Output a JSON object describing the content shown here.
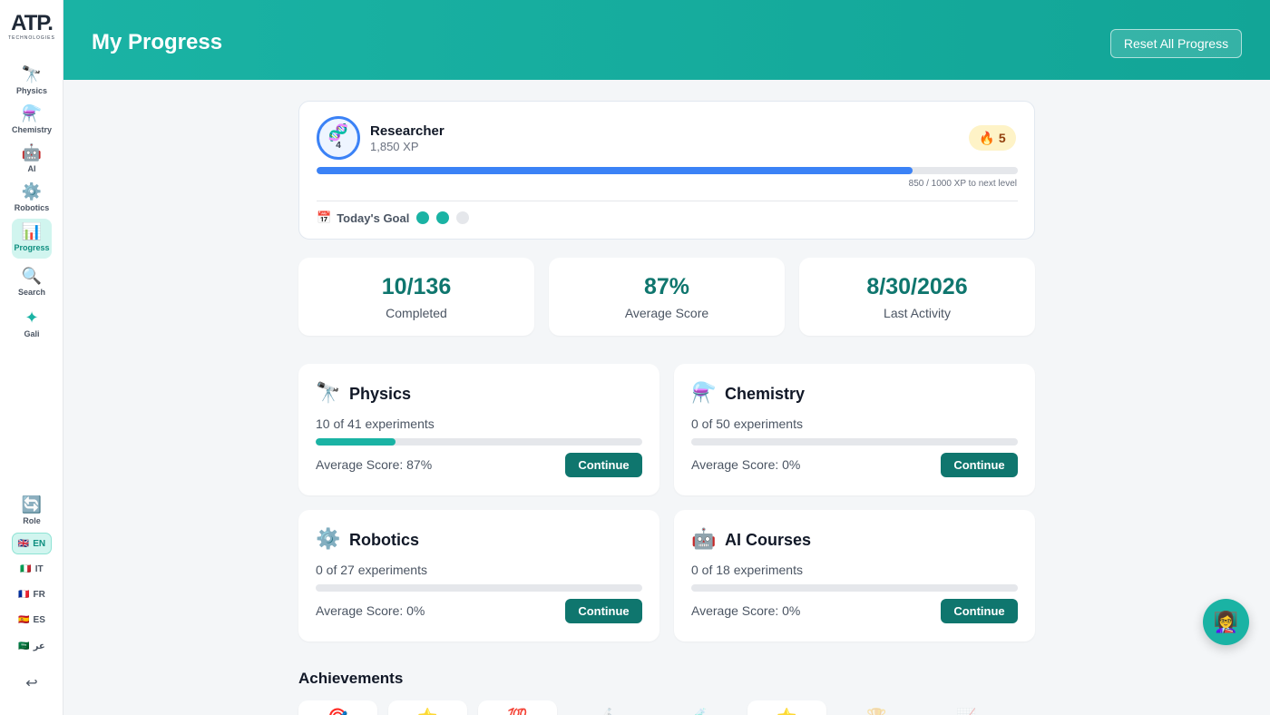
{
  "brand": {
    "logo": "ATP",
    "logo_dot": ".",
    "tagline": "TECHNOLOGIES"
  },
  "sidebar": {
    "items": [
      {
        "icon": "🔭",
        "label": "Physics"
      },
      {
        "icon": "⚗️",
        "label": "Chemistry"
      },
      {
        "icon": "🤖",
        "label": "AI"
      },
      {
        "icon": "⚙️",
        "label": "Robotics"
      },
      {
        "icon": "📊",
        "label": "Progress"
      },
      {
        "icon": "🔍",
        "label": "Search"
      },
      {
        "icon": "✦",
        "label": "Gali"
      }
    ],
    "role": {
      "icon": "🔄",
      "label": "Role"
    },
    "languages": [
      {
        "flag": "🇬🇧",
        "code": "EN"
      },
      {
        "flag": "🇮🇹",
        "code": "IT"
      },
      {
        "flag": "🇫🇷",
        "code": "FR"
      },
      {
        "flag": "🇪🇸",
        "code": "ES"
      },
      {
        "flag": "🇸🇦",
        "code": "عر"
      }
    ],
    "logout_icon": "↩"
  },
  "header": {
    "title": "My Progress",
    "reset_label": "Reset All Progress"
  },
  "profile": {
    "avatar_icon": "🧬",
    "level": "4",
    "rank": "Researcher",
    "xp": "1,850 XP",
    "streak_icon": "🔥",
    "streak": "5",
    "xp_progress": 0.85,
    "xp_next": "850 / 1000 XP to next level",
    "goal_icon": "📅",
    "goal_label": "Today's Goal",
    "goal_done": 2,
    "goal_total": 3
  },
  "stats": [
    {
      "value": "10/136",
      "label": "Completed"
    },
    {
      "value": "87%",
      "label": "Average Score"
    },
    {
      "value": "8/30/2026",
      "label": "Last Activity"
    }
  ],
  "subjects": [
    {
      "icon": "🔭",
      "title": "Physics",
      "count": "10 of 41 experiments",
      "progress": 0.244,
      "score": "Average Score: 87%",
      "button": "Continue"
    },
    {
      "icon": "⚗️",
      "title": "Chemistry",
      "count": "0 of 50 experiments",
      "progress": 0,
      "score": "Average Score: 0%",
      "button": "Continue"
    },
    {
      "icon": "⚙️",
      "title": "Robotics",
      "count": "0 of 27 experiments",
      "progress": 0,
      "score": "Average Score: 0%",
      "button": "Continue"
    },
    {
      "icon": "🤖",
      "title": "AI Courses",
      "count": "0 of 18 experiments",
      "progress": 0,
      "score": "Average Score: 0%",
      "button": "Continue"
    }
  ],
  "achievements": {
    "title": "Achievements",
    "badges": [
      "🎯",
      "⭐",
      "💯",
      "🔬",
      "🧪",
      "⭐",
      "🏆",
      "📈"
    ]
  },
  "assistant": {
    "icon": "👩‍🏫"
  }
}
